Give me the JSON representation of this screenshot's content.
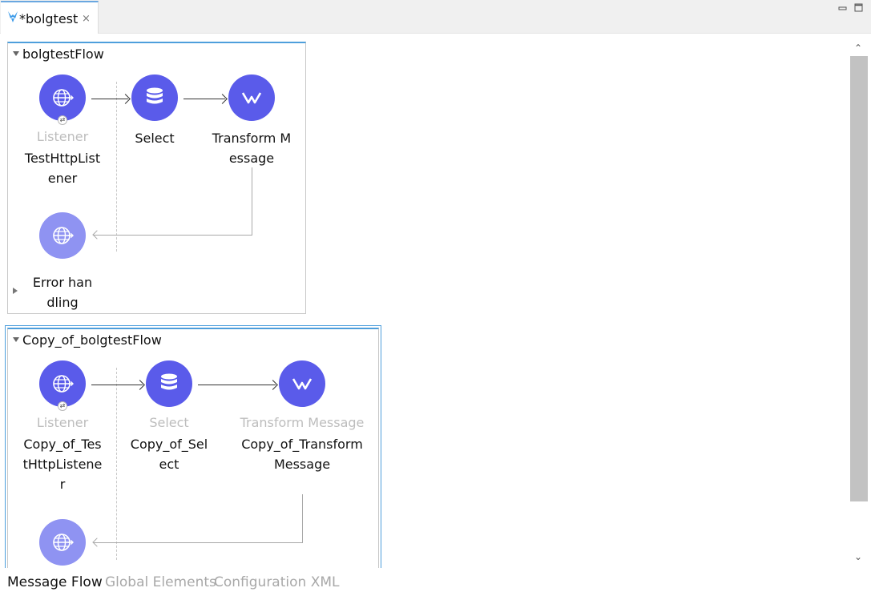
{
  "editor_tab": {
    "title": "*bolgtest",
    "close_glyph": "×",
    "icon": "mule-icon"
  },
  "flows": [
    {
      "name": "bolgtestFlow",
      "components": [
        {
          "type": "Listener",
          "name": "TestHttpListener",
          "icon": "globe-icon"
        },
        {
          "type": "",
          "name": "Select",
          "icon": "database-icon"
        },
        {
          "type": "",
          "name": "Transform Message",
          "icon": "transform-icon"
        }
      ],
      "response_icon": "globe-icon",
      "error_handling": "Error handling"
    },
    {
      "name": "Copy_of_bolgtestFlow",
      "components": [
        {
          "type": "Listener",
          "name": "Copy_of_TestHttpListener",
          "icon": "globe-icon"
        },
        {
          "type": "Select",
          "name": "Copy_of_Select",
          "icon": "database-icon"
        },
        {
          "type": "Transform Message",
          "name": "Copy_of_Transform Message",
          "icon": "transform-icon"
        }
      ],
      "response_icon": "globe-icon"
    }
  ],
  "bottom_tabs": [
    {
      "label": "Message Flow",
      "active": true
    },
    {
      "label": "Global Elements",
      "active": false
    },
    {
      "label": "Configuration XML",
      "active": false
    }
  ],
  "colors": {
    "component": "#5a5bea",
    "component_light": "#8f93f2",
    "flow_accent": "#4e9fdc"
  }
}
